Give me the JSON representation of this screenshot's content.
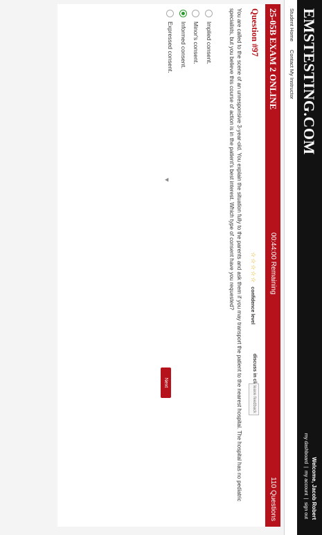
{
  "header": {
    "logo": "EMSTESTING.COM",
    "welcome": "Welcome, Jacob Robert",
    "links": [
      "my dashboard",
      "my account",
      "sign out"
    ],
    "separator": "|"
  },
  "nav": {
    "home": "Student Home",
    "contact": "Contact My Instructor"
  },
  "exam": {
    "title": "25-05B EXAM 2 ONLINE",
    "timer": "00:44:00 Remaining",
    "question_count": "110 Questions"
  },
  "question": {
    "number": "Question #97",
    "stars": "☆☆☆☆☆",
    "confidence_label": "confidence level",
    "discuss_label": "discuss in class",
    "feedback_label": "leave feedback",
    "text": "You are called to the scene of an unresponsive 3-year-old. You explain the situation fully to the parents and ask them if you may transport the patient to the nearest hospital. The hospital has no pediatric specialists, but you believe this course of action is in the patient's best interest. Which type of consent have you requested?",
    "options": [
      {
        "label": "Implied consent.",
        "selected": false
      },
      {
        "label": "Minor's consent.",
        "selected": false
      },
      {
        "label": "Informed consent.",
        "selected": true
      },
      {
        "label": "Expressed consent.",
        "selected": false
      }
    ],
    "next_label": "Next"
  },
  "colors": {
    "brand_red": "#b5121b",
    "selected_green": "#2a9a2a",
    "topbar": "#121212"
  }
}
